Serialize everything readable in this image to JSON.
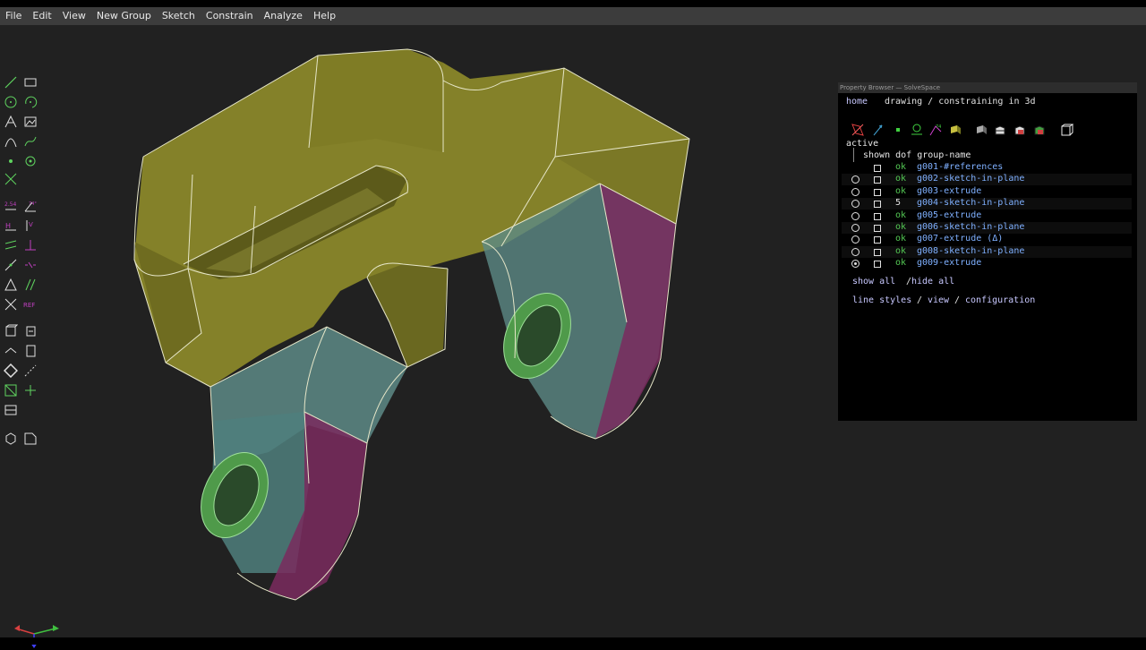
{
  "menu": [
    "File",
    "Edit",
    "View",
    "New Group",
    "Sketch",
    "Constrain",
    "Analyze",
    "Help"
  ],
  "toolbar_icons": [
    "line-icon",
    "rectangle-icon",
    "circle-icon",
    "arc-icon",
    "text-icon",
    "image-icon",
    "tangent-arc-icon",
    "cubic-spline-icon",
    "datum-point-icon",
    "workplane-icon",
    "trim-icon",
    "distance-constraint-icon",
    "angle-constraint-icon",
    "horizontal-constraint-icon",
    "vertical-constraint-icon",
    "parallel-constraint-icon",
    "perpendicular-constraint-icon",
    "point-on-line-icon",
    "symmetric-constraint-icon",
    "equal-length-icon",
    "same-orientation-icon",
    "other-supplementary-icon",
    "reference-icon",
    "nearest-isometric-icon",
    "nearest-ortho-icon",
    "show-construction-icon",
    "show-workplanes-icon",
    "show-faces-icon",
    "show-edges-icon",
    "show-outlines-icon",
    "show-normals-icon",
    "show-text-window-icon",
    "show-mesh-icon",
    "export-icon",
    "sketch-in-plane-icon"
  ],
  "browser": {
    "title": "Property Browser — SolveSpace",
    "nav_home": "home",
    "nav_title": "drawing / constraining in 3d",
    "active_label": "active",
    "header": "shown dof group-name",
    "groups": [
      {
        "radio": false,
        "radio_selected": false,
        "dof": "ok",
        "name": "g001-#references"
      },
      {
        "radio": true,
        "radio_selected": false,
        "dof": "ok",
        "name": "g002-sketch-in-plane"
      },
      {
        "radio": true,
        "radio_selected": false,
        "dof": "ok",
        "name": "g003-extrude"
      },
      {
        "radio": true,
        "radio_selected": false,
        "dof": "5",
        "name": "g004-sketch-in-plane"
      },
      {
        "radio": true,
        "radio_selected": false,
        "dof": "ok",
        "name": "g005-extrude"
      },
      {
        "radio": true,
        "radio_selected": false,
        "dof": "ok",
        "name": "g006-sketch-in-plane"
      },
      {
        "radio": true,
        "radio_selected": false,
        "dof": "ok",
        "name": "g007-extrude (Δ)"
      },
      {
        "radio": true,
        "radio_selected": false,
        "dof": "ok",
        "name": "g008-sketch-in-plane"
      },
      {
        "radio": true,
        "radio_selected": true,
        "dof": "ok",
        "name": "g009-extrude"
      }
    ],
    "show_all": "show all",
    "sep": " / ",
    "hide_all": "hide all",
    "line_styles": "line styles",
    "view": "view",
    "configuration": "configuration"
  },
  "colors": {
    "menubar": "#3c3c3c",
    "viewport": "#212121",
    "model_yellow": "#8d8a2a",
    "model_teal": "#5d8a86",
    "model_magenta": "#7a2a5e",
    "hole_green": "#4f9a4a",
    "ok_green": "#54c854"
  }
}
